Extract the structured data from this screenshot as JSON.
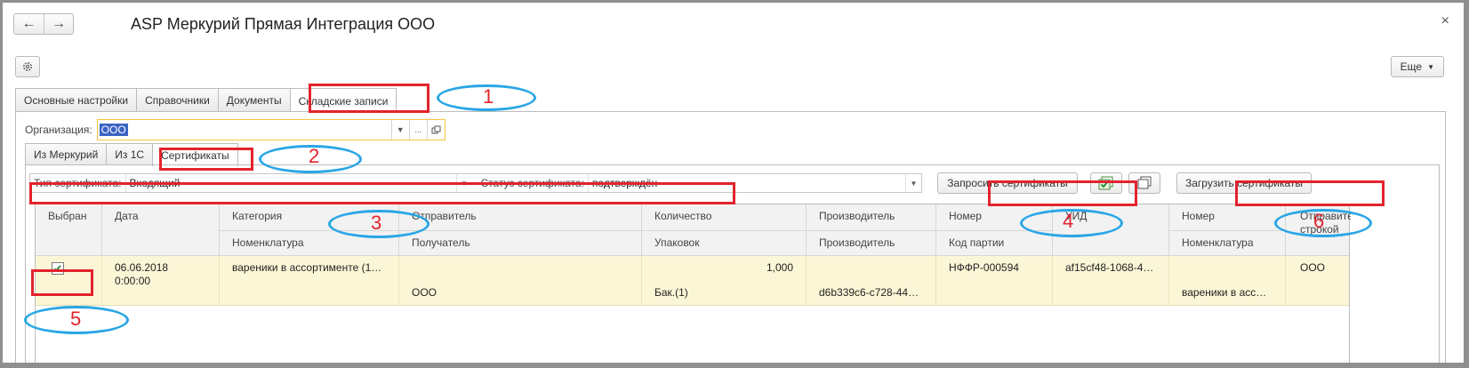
{
  "window": {
    "title": "ASP Меркурий Прямая Интеграция ООО",
    "close": "×",
    "back": "←",
    "forward": "→"
  },
  "toolbar": {
    "more_label": "Еще"
  },
  "tabs_main": [
    "Основные настройки",
    "Справочники",
    "Документы",
    "Складские записи"
  ],
  "organization": {
    "label": "Организация:",
    "value": "ООО",
    "ellipsis": "..."
  },
  "tabs_sub": [
    "Из Меркурий",
    "Из 1С",
    "Сертификаты"
  ],
  "filters": {
    "type_label": "Тип сертификата:",
    "type_value": "Входящий",
    "status_label": "Статус сертификата:",
    "status_value": "подтверждён"
  },
  "buttons": {
    "request": "Запросить сертификаты",
    "load": "Загрузить сертификаты"
  },
  "columns": {
    "top": [
      "Выбран",
      "Дата",
      "Категория",
      "Отправитель",
      "Количество",
      "Производитель",
      "Номер",
      "УИД",
      "Номер",
      "Отправитель строкой"
    ],
    "bottom": [
      "Номенклатура",
      "Получатель",
      "Упаковок",
      "Производитель",
      "Код партии",
      "Номенклатура"
    ]
  },
  "row": {
    "date": "06.06.2018",
    "time": "0:00:00",
    "category": "вареники в ассортименте (1…",
    "quantity": "1,000",
    "number": "НФФР-000594",
    "uid": "af15cf48-1068-4…",
    "sender_str": "ООО",
    "receiver": "ООО",
    "packages": "Бак.(1)",
    "manufacturer": "d6b339c6-c728-44…",
    "nomenclature": "вареники в асс…"
  },
  "annotations": [
    "1",
    "2",
    "3",
    "4",
    "5",
    "6"
  ],
  "colors": {
    "annotation_red": "#e3232e",
    "annotation_blue": "#2aa6e6",
    "selected_row": "#fbf6d6",
    "org_highlight": "#3b62c4"
  }
}
